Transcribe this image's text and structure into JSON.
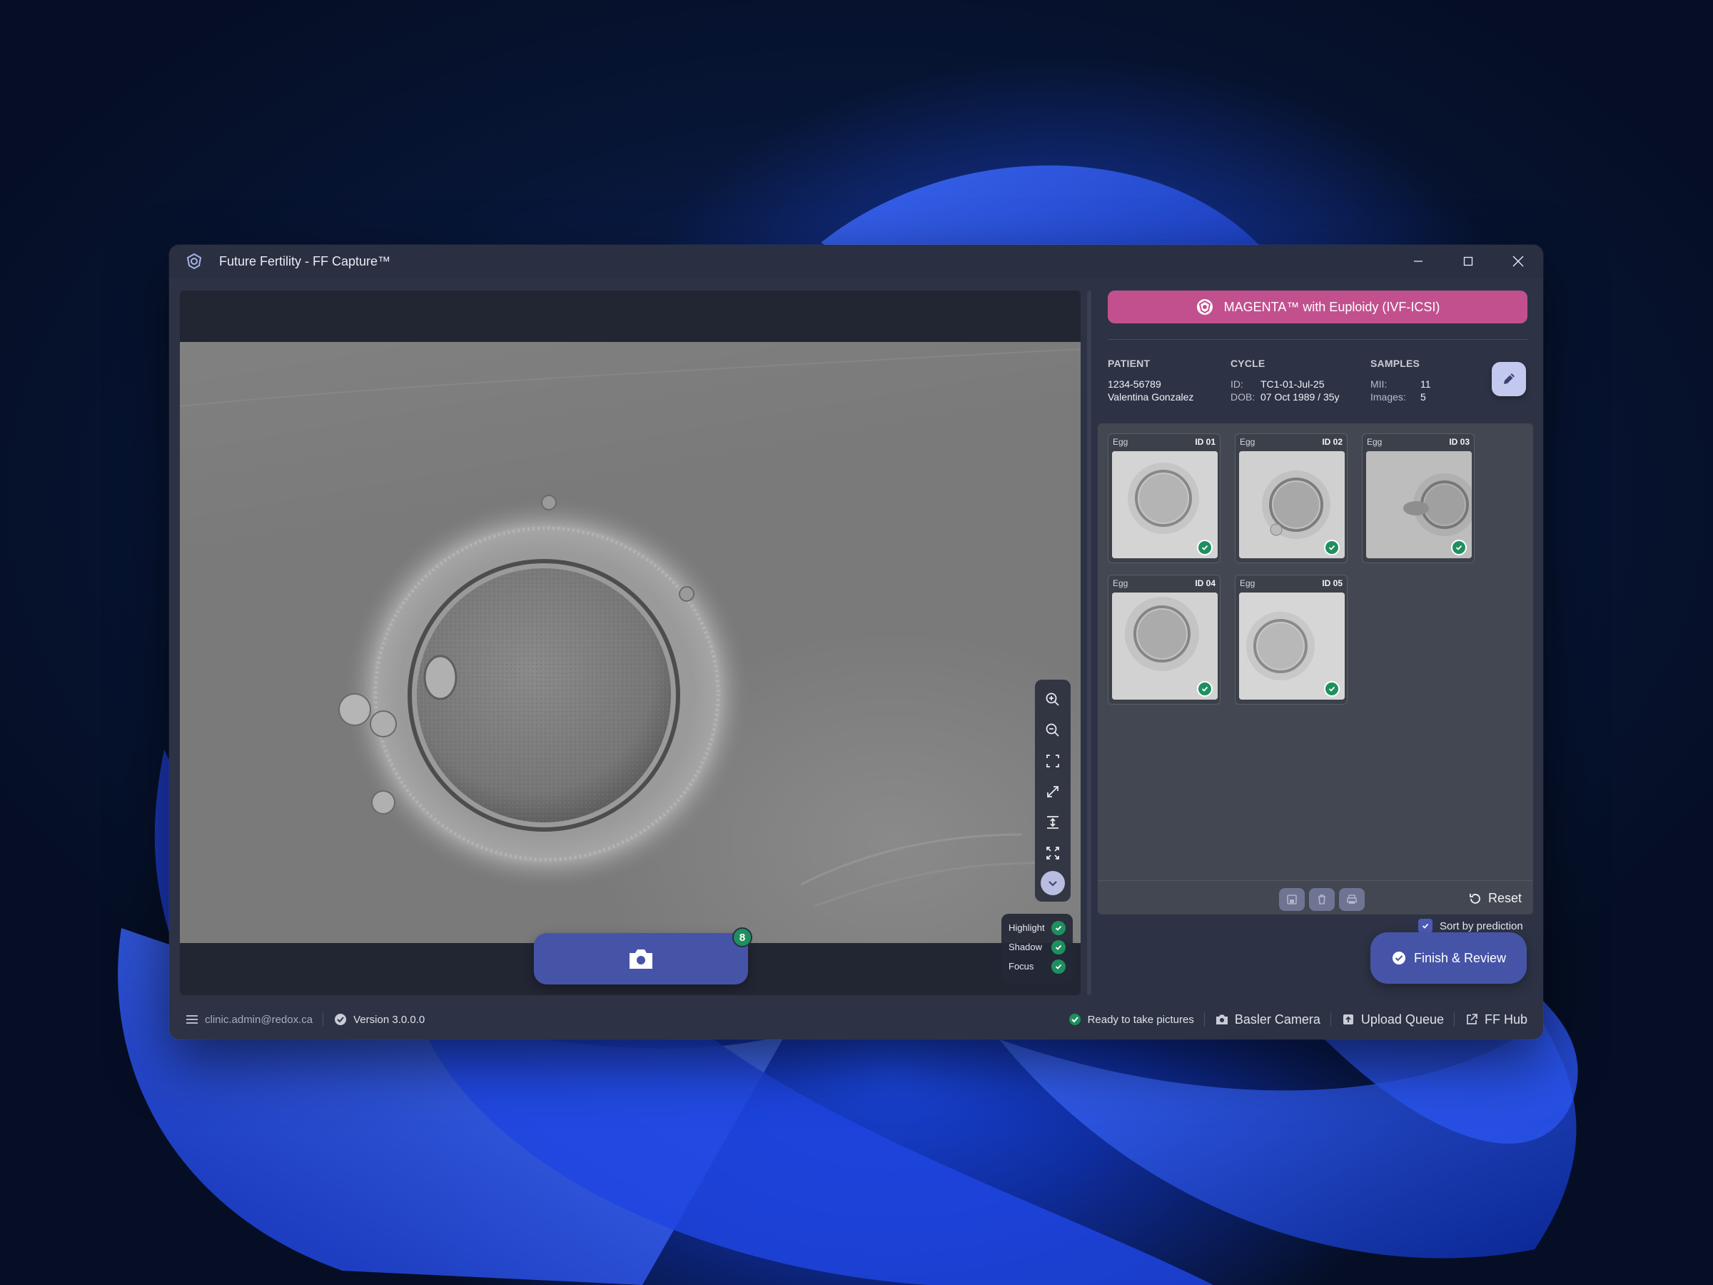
{
  "window": {
    "title": "Future Fertility - FF Capture™",
    "controls": {
      "minimize": "minimize-icon",
      "maximize": "maximize-icon",
      "close": "close-icon"
    }
  },
  "viewer": {
    "capture_badge": "8",
    "tools": [
      "zoom-in-icon",
      "zoom-out-icon",
      "fit-icon",
      "expand-icon",
      "vertical-fit-icon",
      "fullscreen-icon",
      "chevron-down-icon"
    ],
    "quality": [
      {
        "label": "Highlight",
        "ok": true
      },
      {
        "label": "Shadow",
        "ok": true
      },
      {
        "label": "Focus",
        "ok": true
      }
    ]
  },
  "program": {
    "label": "MAGENTA™ with Euploidy (IVF-ICSI)",
    "color": "#c2508e"
  },
  "patient": {
    "heading": "PATIENT",
    "id": "1234-56789",
    "name": "Valentina Gonzalez"
  },
  "cycle": {
    "heading": "CYCLE",
    "id_key": "ID:",
    "id_value": "TC1-01-Jul-25",
    "dob_key": "DOB:",
    "dob_value": "07 Oct 1989 / 35y"
  },
  "samples": {
    "heading": "SAMPLES",
    "mii_key": "MII:",
    "mii_value": "11",
    "images_key": "Images:",
    "images_value": "5"
  },
  "cards": [
    {
      "type": "Egg",
      "id": "ID 01"
    },
    {
      "type": "Egg",
      "id": "ID 02"
    },
    {
      "type": "Egg",
      "id": "ID 03"
    },
    {
      "type": "Egg",
      "id": "ID 04"
    },
    {
      "type": "Egg",
      "id": "ID 05"
    }
  ],
  "grid_footer": {
    "reset_label": "Reset"
  },
  "actions": {
    "sort_label": "Sort by prediction",
    "sort_checked": true,
    "finish_label": "Finish & Review"
  },
  "status": {
    "user": "clinic.admin@redox.ca",
    "version": "Version 3.0.0.0",
    "ready": "Ready to take pictures",
    "camera": "Basler Camera",
    "upload": "Upload Queue",
    "hub": "FF Hub"
  },
  "colors": {
    "accent": "#4654a8",
    "success": "#1f8f5f",
    "magenta": "#c2508e"
  }
}
